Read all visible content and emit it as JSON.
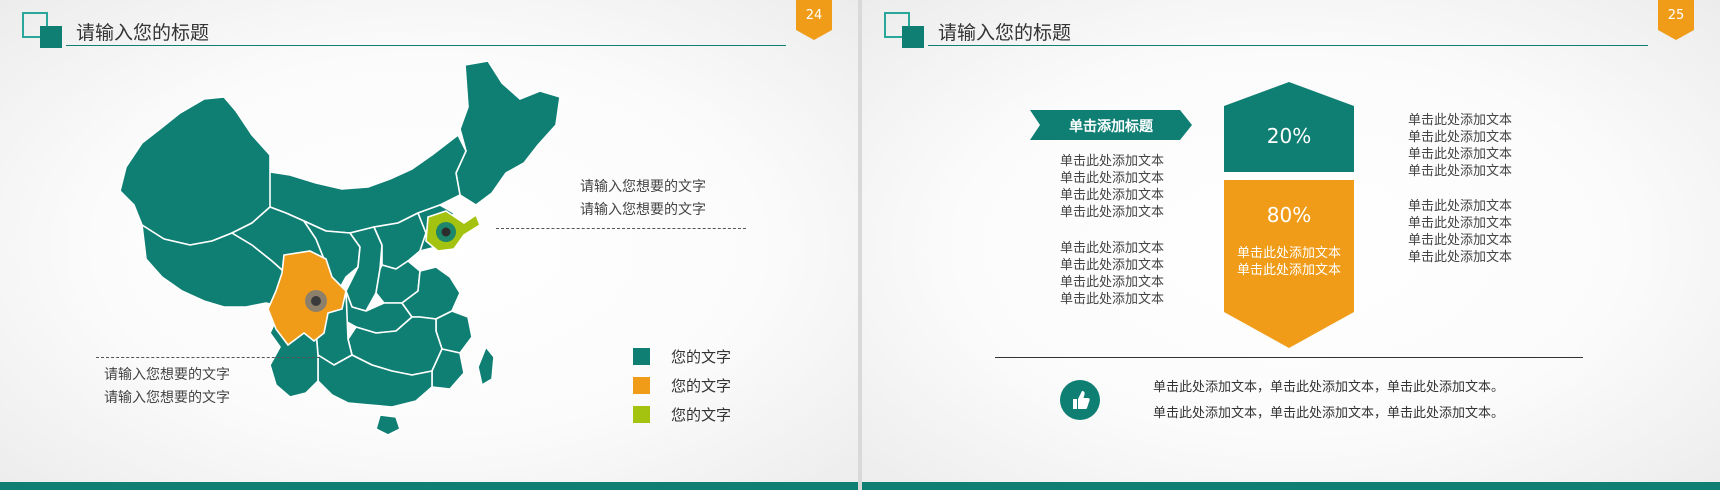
{
  "slides": [
    {
      "title": "请输入您的标题",
      "page_number": "24",
      "callout_right": [
        "请输入您想要的文字",
        "请输入您想要的文字"
      ],
      "callout_left": [
        "请输入您想要的文字",
        "请输入您想要的文字"
      ],
      "legend": [
        {
          "label": "您的文字",
          "color": "#0f7f74"
        },
        {
          "label": "您的文字",
          "color": "#f09c19"
        },
        {
          "label": "您的文字",
          "color": "#a3c310"
        }
      ]
    },
    {
      "title": "请输入您的标题",
      "page_number": "25",
      "ribbon_title": "单击添加标题",
      "left_group_1": [
        "单击此处添加文本",
        "单击此处添加文本",
        "单击此处添加文本",
        "单击此处添加文本"
      ],
      "left_group_2": [
        "单击此处添加文本",
        "单击此处添加文本",
        "单击此处添加文本",
        "单击此处添加文本"
      ],
      "top_percent": "20%",
      "bottom_percent": "80%",
      "center_text": [
        "单击此处添加文本",
        "单击此处添加文本"
      ],
      "right_group_1": [
        "单击此处添加文本",
        "单击此处添加文本",
        "单击此处添加文本",
        "单击此处添加文本"
      ],
      "right_group_2": [
        "单击此处添加文本",
        "单击此处添加文本",
        "单击此处添加文本",
        "单击此处添加文本"
      ],
      "footer_lines": [
        "单击此处添加文本，单击此处添加文本，单击此处添加文本。",
        "单击此处添加文本，单击此处添加文本，单击此处添加文本。"
      ]
    }
  ],
  "colors": {
    "teal": "#0f7f74",
    "orange": "#f09c19",
    "green": "#a3c310",
    "teal_light": "#2aa79b"
  },
  "icons": {
    "thumb": "thumbs-up-icon"
  }
}
